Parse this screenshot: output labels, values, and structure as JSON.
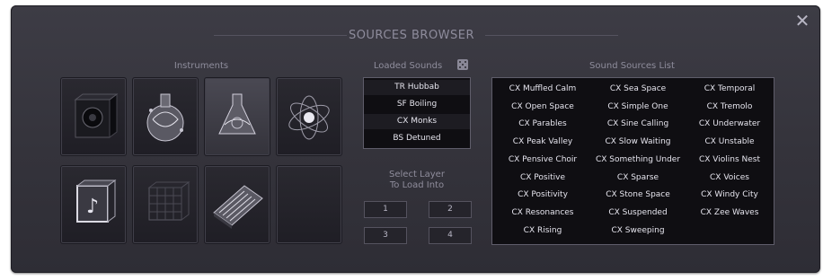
{
  "window": {
    "title": "SOURCES BROWSER"
  },
  "instruments": {
    "label": "Instruments",
    "tiles": [
      {
        "icon": "subwoofer-icon"
      },
      {
        "icon": "glass-flask-icon"
      },
      {
        "icon": "glass-flask-selected-icon",
        "selected": true
      },
      {
        "icon": "atom-orb-icon"
      },
      {
        "icon": "music-note-cube-icon"
      },
      {
        "icon": "wire-cube-icon"
      },
      {
        "icon": "modular-synth-icon"
      },
      {
        "icon": "empty-slot"
      }
    ]
  },
  "loaded_sounds": {
    "label": "Loaded Sounds",
    "items": [
      "TR Hubbab",
      "SF Boiling",
      "CX Monks",
      "BS Detuned"
    ]
  },
  "select_layer": {
    "label_line1": "Select Layer",
    "label_line2": "To Load Into",
    "buttons": [
      "1",
      "2",
      "3",
      "4"
    ]
  },
  "sound_sources": {
    "label": "Sound Sources List",
    "columns": [
      [
        "CX Muffled Calm",
        "CX Open Space",
        "CX Parables",
        "CX Peak Valley",
        "CX Pensive Choir",
        "CX Positive",
        "CX Positivity",
        "CX Resonances",
        "CX Rising"
      ],
      [
        "CX Sea Space",
        "CX Simple One",
        "CX Sine Calling",
        "CX Slow Waiting",
        "CX Something Under",
        "CX Sparse",
        "CX Stone Space",
        "CX Suspended",
        "CX Sweeping"
      ],
      [
        "CX Temporal",
        "CX Tremolo",
        "CX Underwater",
        "CX Unstable",
        "CX Violins Nest",
        "CX Voices",
        "CX Windy City",
        "CX Zee Waves"
      ]
    ]
  }
}
